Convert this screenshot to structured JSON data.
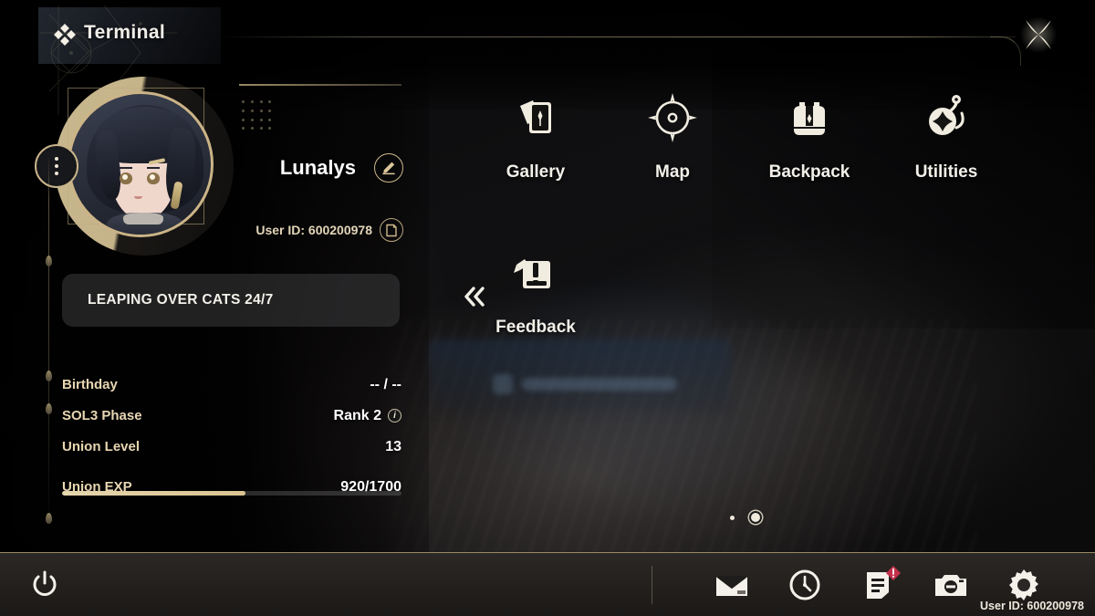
{
  "header": {
    "title": "Terminal",
    "title_icon": "four-diamonds-icon",
    "close_icon": "star-close-icon"
  },
  "profile": {
    "avatar_alt": "character-portrait",
    "avatar_menu_icon": "three-dots-icon",
    "name": "Lunalys",
    "edit_icon": "pencil-edit-icon",
    "user_id_label": "User ID: 600200978",
    "copy_icon": "copy-icon",
    "signature": "LEAPING OVER CATS 24/7",
    "stats": [
      {
        "label": "Birthday",
        "value": "-- / --",
        "info": false
      },
      {
        "label": "SOL3 Phase",
        "value": "Rank 2",
        "info": true
      },
      {
        "label": "Union Level",
        "value": "13",
        "info": false
      }
    ],
    "exp": {
      "label": "Union EXP",
      "value": "920/1700",
      "current": 920,
      "max": 1700,
      "percent": 54
    }
  },
  "menu": {
    "collapse_icon": "double-chevron-left-icon",
    "items": [
      {
        "label": "Gallery",
        "icon": "cards-icon"
      },
      {
        "label": "Map",
        "icon": "compass-icon"
      },
      {
        "label": "Backpack",
        "icon": "backpack-icon"
      },
      {
        "label": "Utilities",
        "icon": "gadget-icon"
      },
      {
        "label": "Feedback",
        "icon": "feedback-note-icon"
      }
    ],
    "page_dots": {
      "count": 2,
      "active_index": 1
    }
  },
  "bottom_bar": {
    "power_icon": "power-icon",
    "icons": [
      {
        "name": "mail-icon",
        "badge": false
      },
      {
        "name": "clock-icon",
        "badge": false
      },
      {
        "name": "notes-icon",
        "badge": true
      },
      {
        "name": "camera-icon",
        "badge": false
      },
      {
        "name": "settings-gear-icon",
        "badge": false
      }
    ],
    "user_id_label": "User ID: 600200978"
  },
  "colors": {
    "gold": "#cbb487",
    "gold_light": "#e6d6ae",
    "text": "#f3f0e9",
    "label": "#e8d6b2",
    "badge_red": "#c2304a",
    "bar_bg": "#2b2825"
  }
}
